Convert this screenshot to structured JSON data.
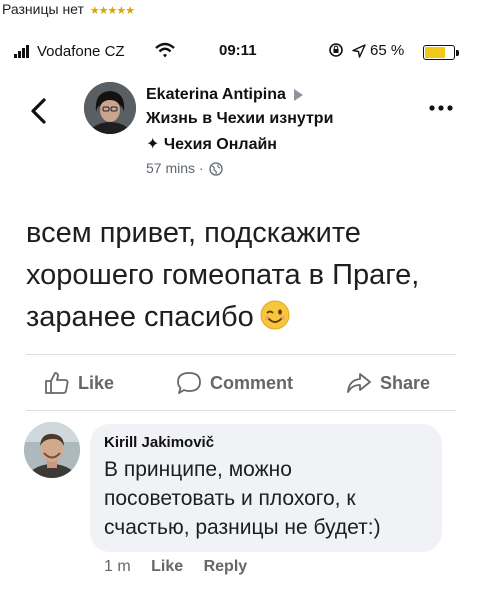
{
  "caption": {
    "text": "Разницы нет",
    "stars": "★★★★★",
    "stars_color": "#d8a800"
  },
  "status_bar": {
    "carrier": "Vodafone CZ",
    "time": "09:11",
    "battery_percent_label": "65 %",
    "battery_level": 0.65,
    "battery_fill_color": "#f2c819",
    "icons": [
      "signal-icon",
      "wifi-icon",
      "lock-rotation-icon",
      "location-icon",
      "battery-icon"
    ]
  },
  "post": {
    "author": "Ekaterina Antipina",
    "group": "Жизнь в Чехии изнутри",
    "page": "✦ Чехия Онлайн",
    "time": "57 mins · ",
    "text": "всем привет, подскажите хорошего гомеопата в Праге, заранее спасибо",
    "emoji": "winking-face-emoji"
  },
  "actions": {
    "like": "Like",
    "comment": "Comment",
    "share": "Share",
    "color": "#65676b"
  },
  "comment": {
    "author": "Kirill Jakimovič",
    "text": "В принципе, можно посоветовать и плохого, к счастью, разницы не будет:)",
    "time": "1 m",
    "like": "Like",
    "reply": "Reply",
    "bubble_color": "#f0f2f5"
  }
}
